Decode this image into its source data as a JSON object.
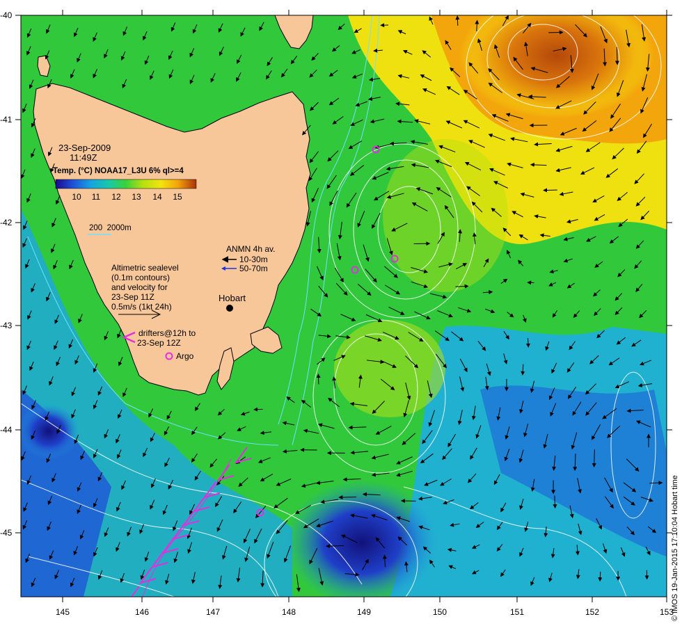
{
  "map": {
    "date": "23-Sep-2009",
    "time": "11:49Z",
    "colorbar_title": "Temp. (°C) NOAA17_L3U 6% ql>=4",
    "colorbar_ticks": [
      "10",
      "11",
      "12",
      "13",
      "14",
      "15"
    ],
    "colorbar_colors": [
      "#1a0a8a",
      "#1f4fd8",
      "#16a3e0",
      "#19c9a8",
      "#3bd23a",
      "#b6e00f",
      "#f2e40d",
      "#f4a30c",
      "#d9680a",
      "#a8320a"
    ],
    "isobath_label": "200  2000m",
    "anmn_title": "ANMN 4h av.",
    "anmn_shallow": "10-30m",
    "anmn_deep": "50-70m",
    "sealevel_lines": [
      "Altimetric sealevel",
      "(0.1m contours)",
      "and velocity for",
      "23-Sep 11Z",
      "0.5m/s (1kt 24h)"
    ],
    "drifters_lines": [
      "drifters@12h to",
      "23-Sep 12Z"
    ],
    "argo_label": "Argo",
    "city_label": "Hobart",
    "credit": "© IMOS 19-Jan-2015 17:10:04 Hobart time",
    "x_ticks": [
      "145",
      "146",
      "147",
      "148",
      "149",
      "150",
      "151",
      "152",
      "153"
    ],
    "y_ticks": [
      "-40",
      "-41",
      "-42",
      "-43",
      "-44",
      "-45"
    ],
    "colors": {
      "land": "#f7c79a",
      "warm_sst": "#d9680a",
      "cold_sst": "#1f4fd8",
      "drifter": "#e030e0",
      "contour": "#ffffff",
      "isobath": "#6fe0ff"
    }
  }
}
